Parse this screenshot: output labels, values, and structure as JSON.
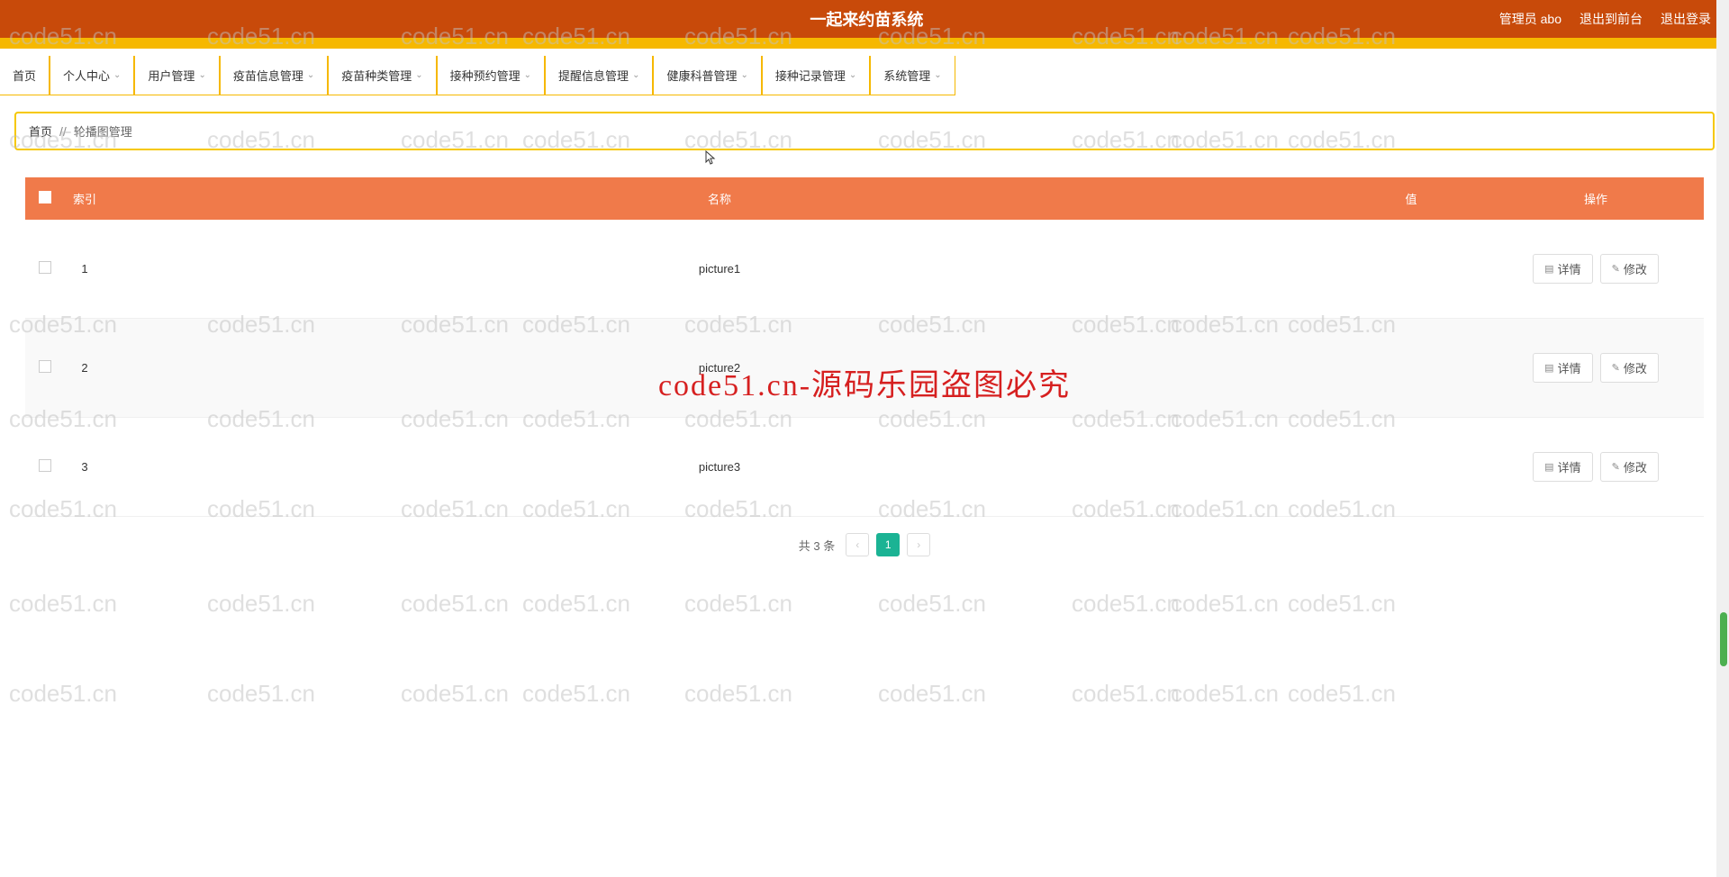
{
  "header": {
    "title": "一起来约苗系统",
    "admin_label": "管理员 abo",
    "exit_front": "退出到前台",
    "logout": "退出登录"
  },
  "nav": {
    "items": [
      {
        "label": "首页",
        "has_dropdown": false
      },
      {
        "label": "个人中心",
        "has_dropdown": true
      },
      {
        "label": "用户管理",
        "has_dropdown": true
      },
      {
        "label": "疫苗信息管理",
        "has_dropdown": true
      },
      {
        "label": "疫苗种类管理",
        "has_dropdown": true
      },
      {
        "label": "接种预约管理",
        "has_dropdown": true
      },
      {
        "label": "提醒信息管理",
        "has_dropdown": true
      },
      {
        "label": "健康科普管理",
        "has_dropdown": true
      },
      {
        "label": "接种记录管理",
        "has_dropdown": true
      },
      {
        "label": "系统管理",
        "has_dropdown": true
      }
    ]
  },
  "breadcrumb": {
    "home": "首页",
    "sep": "//",
    "current": "轮播图管理"
  },
  "table": {
    "headers": {
      "index": "索引",
      "name": "名称",
      "value": "值",
      "action": "操作"
    },
    "rows": [
      {
        "index": "1",
        "name": "picture1",
        "value": ""
      },
      {
        "index": "2",
        "name": "picture2",
        "value": ""
      },
      {
        "index": "3",
        "name": "picture3",
        "value": ""
      }
    ],
    "action_detail": "详情",
    "action_edit": "修改"
  },
  "pagination": {
    "total_text": "共 3 条",
    "current": "1"
  },
  "watermark": {
    "text": "code51.cn",
    "center_text": "code51.cn-源码乐园盗图必究"
  }
}
